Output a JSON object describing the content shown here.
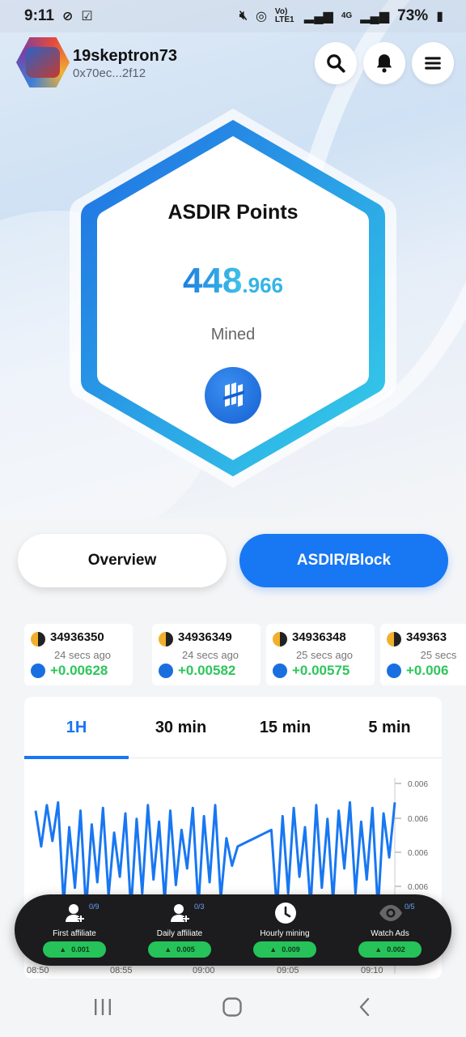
{
  "status_bar": {
    "time": "9:11",
    "network_small": "Vo) LTE1",
    "network_type": "4G",
    "battery": "73%"
  },
  "header": {
    "username": "19skeptron73",
    "address": "0x70ec...2f12"
  },
  "points_card": {
    "title": "ASDIR Points",
    "value_integer": "448",
    "value_decimal": ".966",
    "label": "Mined"
  },
  "toggle": {
    "overview_label": "Overview",
    "block_label": "ASDIR/Block",
    "active": "ASDIR/Block"
  },
  "blocks": [
    {
      "number": "34936350",
      "ago": "24 secs ago",
      "reward": "+0.00628"
    },
    {
      "number": "34936349",
      "ago": "24 secs ago",
      "reward": "+0.00582"
    },
    {
      "number": "34936348",
      "ago": "25 secs ago",
      "reward": "+0.00575"
    },
    {
      "number": "349363",
      "ago": "25 secs",
      "reward": "+0.006"
    }
  ],
  "chart_tabs": {
    "items": [
      "1H",
      "30 min",
      "15 min",
      "5 min"
    ],
    "active": "1H"
  },
  "chart_data": {
    "type": "line",
    "x_ticks": [
      "08:50",
      "08:55",
      "09:00",
      "09:05",
      "09:10"
    ],
    "y_ticks": [
      "0.006",
      "0.006",
      "0.006",
      "0.006",
      "0.006"
    ],
    "series": [
      {
        "values": [
          0.00596,
          0.00583,
          0.00598,
          0.00585,
          0.00599,
          0.00562,
          0.0059,
          0.00568,
          0.00596,
          0.0056,
          0.00591,
          0.0057,
          0.00597,
          0.00565,
          0.00588,
          0.00572,
          0.00595,
          0.0056,
          0.00593,
          0.00566,
          0.00598,
          0.00571,
          0.00592,
          0.00563,
          0.00596,
          0.00569,
          0.00589,
          0.00575,
          0.00597,
          0.00561,
          0.00594,
          0.0057,
          0.00598,
          0.00564,
          0.00586,
          0.00576,
          0.00583,
          0.00584,
          0.00585,
          0.00586,
          0.00587,
          0.00588,
          0.00589,
          0.0056,
          0.00594,
          0.00566,
          0.00597,
          0.00572,
          0.0059,
          0.00561,
          0.00598,
          0.00568,
          0.00593,
          0.00563,
          0.00596,
          0.00575,
          0.00599,
          0.00566,
          0.00592,
          0.00571,
          0.00597,
          0.0056,
          0.00595,
          0.00579,
          0.00599
        ]
      }
    ],
    "color": "#1877f2"
  },
  "mining_bar": [
    {
      "label": "First affiliate",
      "count": "0/9",
      "reward": "0.001",
      "icon": "add-user-icon"
    },
    {
      "label": "Daily affiliate",
      "count": "0/3",
      "reward": "0.005",
      "icon": "add-user-icon"
    },
    {
      "label": "Hourly mining",
      "count": "",
      "reward": "0.009",
      "icon": "clock-icon"
    },
    {
      "label": "Watch Ads",
      "count": "0/5",
      "reward": "0.002",
      "icon": "eye-icon"
    }
  ],
  "colors": {
    "accent": "#1877f2",
    "positive": "#2ec65b",
    "hex_gradient_start": "#1f6fe3",
    "hex_gradient_end": "#35d0e8"
  }
}
